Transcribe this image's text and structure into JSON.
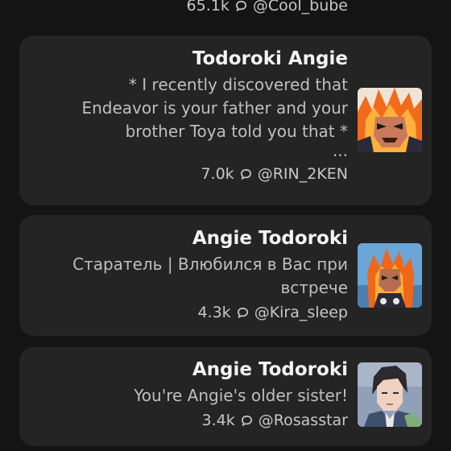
{
  "top_partial": {
    "count": "65.1k",
    "author": "@Cool_bube"
  },
  "cards": [
    {
      "title": "Todoroki Angie",
      "description_lines": [
        "* I recently discovered that",
        "Endeavor is your father and your",
        "brother Toya told you that *",
        "..."
      ],
      "count": "7.0k",
      "author": "@RIN_2KEN",
      "avatar": "flame-hero-avatar"
    },
    {
      "title": "Angie Todoroki",
      "description_lines": [
        "Старатель | Влюбился в Вас при",
        "встрече"
      ],
      "count": "4.3k",
      "author": "@Kira_sleep",
      "avatar": "flame-hero-avatar-2"
    },
    {
      "title": "Angie Todoroki",
      "description_lines": [
        "You're Angie's older sister!"
      ],
      "count": "3.4k",
      "author": "@Rosasstar",
      "avatar": "dark-haired-man-avatar"
    }
  ],
  "icons": {
    "chat": "chat-bubble-icon"
  },
  "colors": {
    "background": "#141414",
    "card": "#242424",
    "title": "#f4f4f4",
    "muted": "#bfbfbf"
  }
}
